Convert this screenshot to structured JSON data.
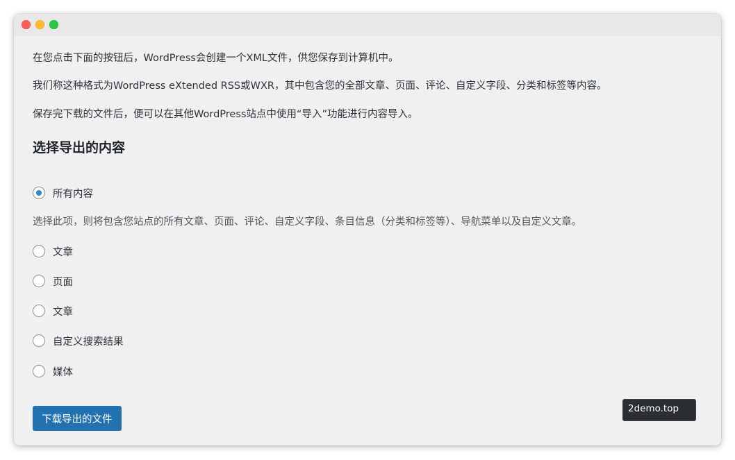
{
  "window": {
    "controls": [
      "close",
      "minimize",
      "maximize"
    ]
  },
  "intro": {
    "p1": "在您点击下面的按钮后，WordPress会创建一个XML文件，供您保存到计算机中。",
    "p2": "我们称这种格式为WordPress eXtended RSS或WXR，其中包含您的全部文章、页面、评论、自定义字段、分类和标签等内容。",
    "p3": "保存完下载的文件后，便可以在其他WordPress站点中使用“导入”功能进行内容导入。"
  },
  "section": {
    "title": "选择导出的内容"
  },
  "options": [
    {
      "label": "所有内容",
      "checked": true
    },
    {
      "label": "文章",
      "checked": false
    },
    {
      "label": "页面",
      "checked": false
    },
    {
      "label": "文章",
      "checked": false
    },
    {
      "label": "自定义搜索结果",
      "checked": false
    },
    {
      "label": "媒体",
      "checked": false
    }
  ],
  "all_content_description": "选择此项，则将包含您站点的所有文章、页面、评论、自定义字段、条目信息（分类和标签等）、导航菜单以及自定义文章。",
  "actions": {
    "download_label": "下载导出的文件"
  },
  "watermark": {
    "text": "2demo.top"
  },
  "colors": {
    "primary": "#2271b1",
    "radio_checked": "#3582c4",
    "background": "#f0f0f1",
    "text": "#1d2327"
  }
}
